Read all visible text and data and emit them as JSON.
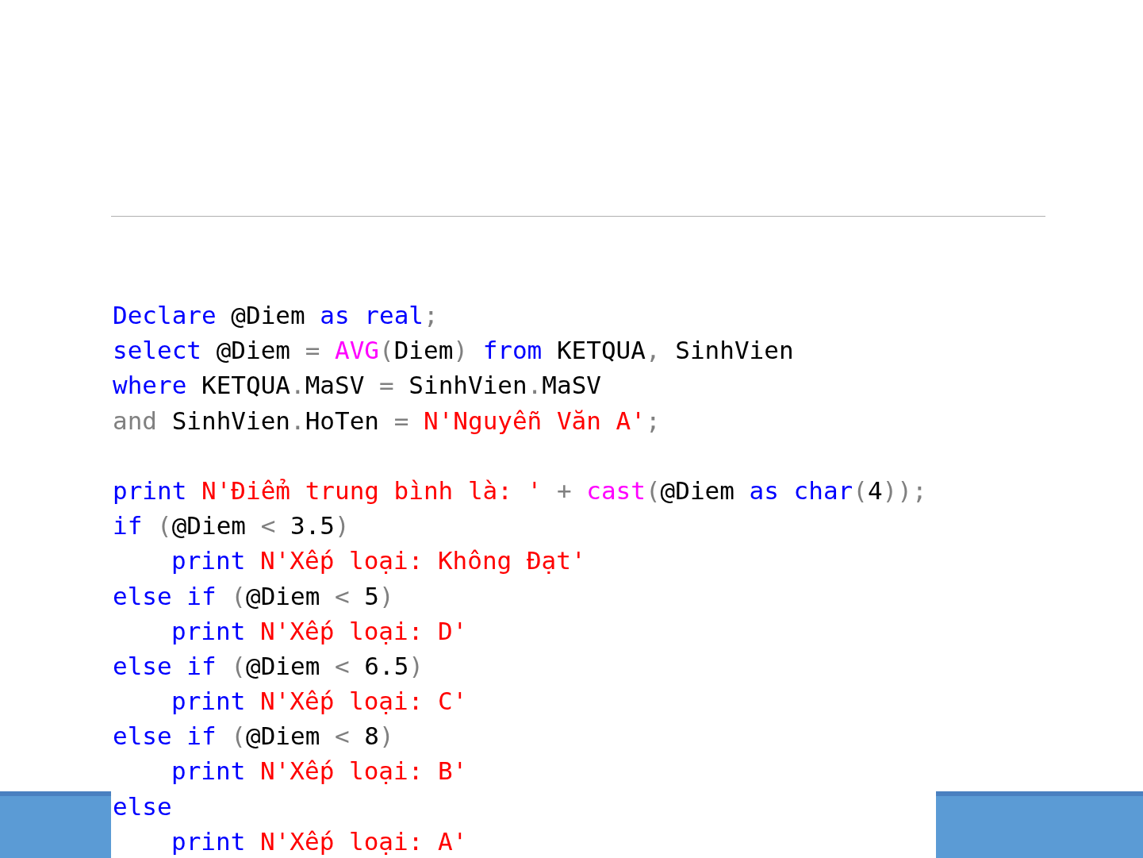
{
  "code_lines": [
    {
      "kind": "code",
      "indented": false,
      "tokens": [
        {
          "text": "Declare",
          "kind": "keyword"
        },
        {
          "text": " @Diem ",
          "kind": "plain"
        },
        {
          "text": "as",
          "kind": "keyword"
        },
        {
          "text": " real",
          "kind": "keyword"
        },
        {
          "text": ";",
          "kind": "operator"
        }
      ]
    },
    {
      "kind": "code",
      "indented": false,
      "tokens": [
        {
          "text": "select",
          "kind": "keyword"
        },
        {
          "text": " @Diem ",
          "kind": "plain"
        },
        {
          "text": "=",
          "kind": "operator"
        },
        {
          "text": " AVG",
          "kind": "function"
        },
        {
          "text": "(",
          "kind": "operator"
        },
        {
          "text": "Diem",
          "kind": "plain"
        },
        {
          "text": ")",
          "kind": "operator"
        },
        {
          "text": " from",
          "kind": "keyword"
        },
        {
          "text": " KETQUA",
          "kind": "plain"
        },
        {
          "text": ",",
          "kind": "operator"
        },
        {
          "text": " SinhVien",
          "kind": "plain"
        }
      ]
    },
    {
      "kind": "code",
      "indented": false,
      "tokens": [
        {
          "text": "where",
          "kind": "keyword"
        },
        {
          "text": " KETQUA",
          "kind": "plain"
        },
        {
          "text": ".",
          "kind": "operator"
        },
        {
          "text": "MaSV ",
          "kind": "plain"
        },
        {
          "text": "=",
          "kind": "operator"
        },
        {
          "text": " SinhVien",
          "kind": "plain"
        },
        {
          "text": ".",
          "kind": "operator"
        },
        {
          "text": "MaSV",
          "kind": "plain"
        }
      ]
    },
    {
      "kind": "code",
      "indented": false,
      "tokens": [
        {
          "text": "and",
          "kind": "operator"
        },
        {
          "text": " SinhVien",
          "kind": "plain"
        },
        {
          "text": ".",
          "kind": "operator"
        },
        {
          "text": "HoTen ",
          "kind": "plain"
        },
        {
          "text": "=",
          "kind": "operator"
        },
        {
          "text": " N'Nguyễn Văn A'",
          "kind": "string"
        },
        {
          "text": ";",
          "kind": "operator"
        }
      ]
    },
    {
      "kind": "blank"
    },
    {
      "kind": "code",
      "indented": false,
      "tokens": [
        {
          "text": "print",
          "kind": "keyword"
        },
        {
          "text": " N'Điểm trung bình là: '",
          "kind": "string"
        },
        {
          "text": " +",
          "kind": "operator"
        },
        {
          "text": " cast",
          "kind": "function"
        },
        {
          "text": "(",
          "kind": "operator"
        },
        {
          "text": "@Diem ",
          "kind": "plain"
        },
        {
          "text": "as",
          "kind": "keyword"
        },
        {
          "text": " char",
          "kind": "keyword"
        },
        {
          "text": "(",
          "kind": "operator"
        },
        {
          "text": "4",
          "kind": "plain"
        },
        {
          "text": "));",
          "kind": "operator"
        }
      ]
    },
    {
      "kind": "code",
      "indented": false,
      "tokens": [
        {
          "text": "if",
          "kind": "keyword"
        },
        {
          "text": " (",
          "kind": "operator"
        },
        {
          "text": "@Diem ",
          "kind": "plain"
        },
        {
          "text": "<",
          "kind": "operator"
        },
        {
          "text": " 3.5",
          "kind": "plain"
        },
        {
          "text": ")",
          "kind": "operator"
        }
      ]
    },
    {
      "kind": "code",
      "indented": true,
      "tokens": [
        {
          "text": "print",
          "kind": "keyword"
        },
        {
          "text": " N'Xếp loại: Không Đạt'",
          "kind": "string"
        }
      ]
    },
    {
      "kind": "code",
      "indented": false,
      "tokens": [
        {
          "text": "else",
          "kind": "keyword"
        },
        {
          "text": " if",
          "kind": "keyword"
        },
        {
          "text": " (",
          "kind": "operator"
        },
        {
          "text": "@Diem ",
          "kind": "plain"
        },
        {
          "text": "<",
          "kind": "operator"
        },
        {
          "text": " 5",
          "kind": "plain"
        },
        {
          "text": ")",
          "kind": "operator"
        }
      ]
    },
    {
      "kind": "code",
      "indented": true,
      "tokens": [
        {
          "text": "print",
          "kind": "keyword"
        },
        {
          "text": " N'Xếp loại: D'",
          "kind": "string"
        }
      ]
    },
    {
      "kind": "code",
      "indented": false,
      "tokens": [
        {
          "text": "else",
          "kind": "keyword"
        },
        {
          "text": " if",
          "kind": "keyword"
        },
        {
          "text": " (",
          "kind": "operator"
        },
        {
          "text": "@Diem ",
          "kind": "plain"
        },
        {
          "text": "<",
          "kind": "operator"
        },
        {
          "text": " 6.5",
          "kind": "plain"
        },
        {
          "text": ")",
          "kind": "operator"
        }
      ]
    },
    {
      "kind": "code",
      "indented": true,
      "tokens": [
        {
          "text": "print",
          "kind": "keyword"
        },
        {
          "text": " N'Xếp loại: C'",
          "kind": "string"
        }
      ]
    },
    {
      "kind": "code",
      "indented": false,
      "tokens": [
        {
          "text": "else",
          "kind": "keyword"
        },
        {
          "text": " if",
          "kind": "keyword"
        },
        {
          "text": " (",
          "kind": "operator"
        },
        {
          "text": "@Diem ",
          "kind": "plain"
        },
        {
          "text": "<",
          "kind": "operator"
        },
        {
          "text": " 8",
          "kind": "plain"
        },
        {
          "text": ")",
          "kind": "operator"
        }
      ]
    },
    {
      "kind": "code",
      "indented": true,
      "tokens": [
        {
          "text": "print",
          "kind": "keyword"
        },
        {
          "text": " N'Xếp loại: B'",
          "kind": "string"
        }
      ]
    },
    {
      "kind": "code",
      "indented": false,
      "tokens": [
        {
          "text": "else",
          "kind": "keyword"
        }
      ]
    },
    {
      "kind": "code",
      "indented": true,
      "tokens": [
        {
          "text": "print",
          "kind": "keyword"
        },
        {
          "text": " N'Xếp loại: A'",
          "kind": "string"
        }
      ]
    }
  ]
}
